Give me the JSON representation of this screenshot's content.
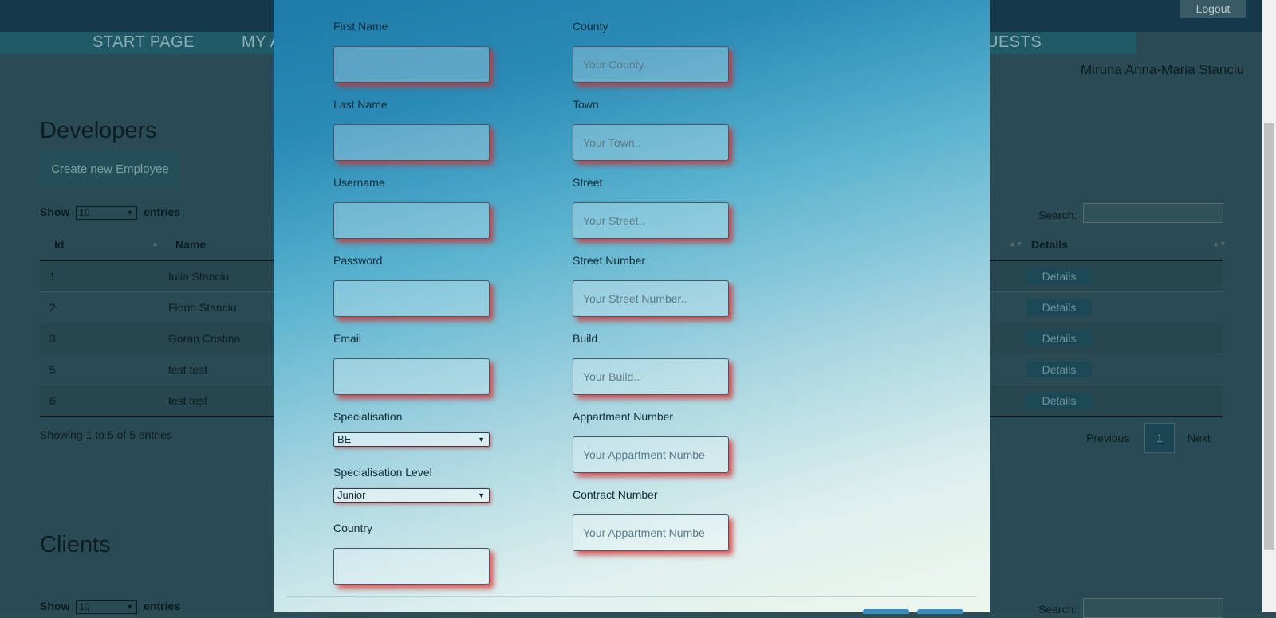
{
  "background": {
    "logout_label": "Logout",
    "nav": [
      {
        "label": "START PAGE"
      },
      {
        "label": "MY A"
      },
      {
        "label": "UESTS"
      }
    ],
    "user_name": "Miruna Anna-Maria Stanciu",
    "developers": {
      "title": "Developers",
      "create_button": "Create new Employee",
      "show_prefix": "Show",
      "show_value": "10",
      "show_suffix": "entries",
      "search_label": "Search:",
      "columns": [
        "Id",
        "Name",
        "Details"
      ],
      "rows": [
        {
          "id": "1",
          "name": "Iulia Stanciu",
          "details": "Details"
        },
        {
          "id": "2",
          "name": "Florin Stanciu",
          "details": "Details"
        },
        {
          "id": "3",
          "name": "Goran Cristina",
          "details": "Details"
        },
        {
          "id": "5",
          "name": "test test",
          "details": "Details"
        },
        {
          "id": "6",
          "name": "test test",
          "details": "Details"
        }
      ],
      "showing": "Showing 1 to 5 of 5 entries",
      "previous": "Previous",
      "page": "1",
      "next": "Next"
    },
    "clients": {
      "title": "Clients",
      "show_prefix": "Show",
      "show_value": "10",
      "show_suffix": "entries",
      "search_label": "Search:"
    }
  },
  "modal": {
    "left_fields": [
      {
        "label": "First Name",
        "placeholder": ""
      },
      {
        "label": "Last Name",
        "placeholder": ""
      },
      {
        "label": "Username",
        "placeholder": ""
      },
      {
        "label": "Password",
        "placeholder": ""
      },
      {
        "label": "Email",
        "placeholder": ""
      }
    ],
    "specialisation": {
      "label": "Specialisation",
      "value": "BE"
    },
    "specialisation_level": {
      "label": "Specialisation Level",
      "value": "Junior"
    },
    "country": {
      "label": "Country",
      "placeholder": ""
    },
    "right_fields": [
      {
        "label": "County",
        "placeholder": "Your County.."
      },
      {
        "label": "Town",
        "placeholder": "Your Town.."
      },
      {
        "label": "Street",
        "placeholder": "Your Street.."
      },
      {
        "label": "Street Number",
        "placeholder": "Your Street Number.."
      },
      {
        "label": "Build",
        "placeholder": "Your Build.."
      },
      {
        "label": "Appartment Number",
        "placeholder": "Your Appartment Numbe"
      },
      {
        "label": "Contract Number",
        "placeholder": "Your Appartment Numbe"
      }
    ],
    "shadow_color": "#dc2828",
    "gradient_top": "#1e7aa8",
    "gradient_bottom": "#eef7ec"
  }
}
